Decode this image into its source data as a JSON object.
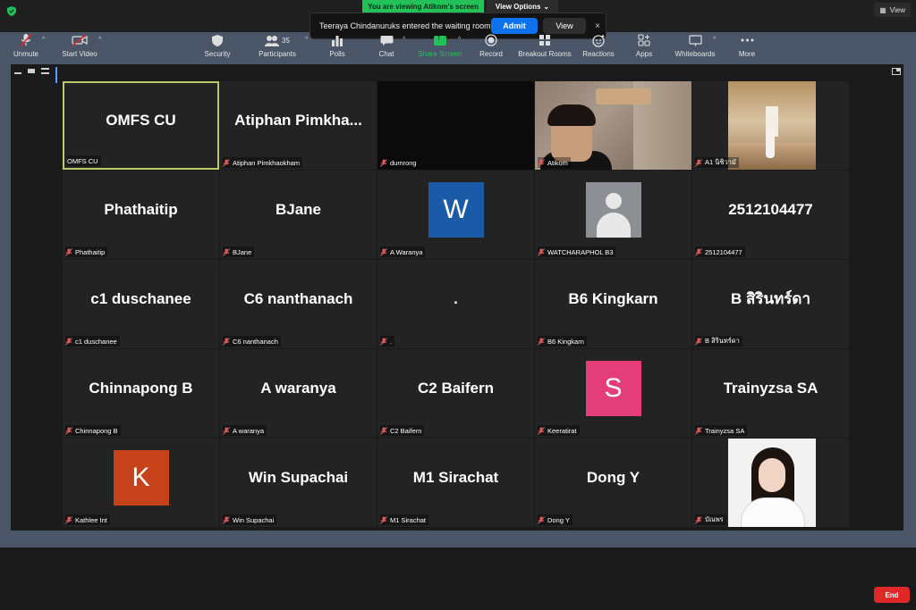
{
  "topbar": {
    "viewing_banner": "You are viewing Atikom's screen",
    "view_options": "View Options",
    "view_button": "View"
  },
  "waiting_toast": {
    "message": "Teeraya Chindanuruks entered the waiting room",
    "admit": "Admit",
    "view": "View",
    "close": "×"
  },
  "participants": [
    {
      "display": "OMFS CU",
      "label": "OMFS CU",
      "type": "name",
      "active": true,
      "muted": false
    },
    {
      "display": "Atiphan  Pimkha...",
      "label": "Atiphan Pimkhaokham",
      "type": "name",
      "muted": true
    },
    {
      "display": "",
      "label": "dumrong",
      "type": "video-dark",
      "muted": true
    },
    {
      "display": "",
      "label": "Atikom",
      "type": "video-cam",
      "muted": true
    },
    {
      "display": "",
      "label": "A1 นิชิวามั",
      "type": "photo-hall",
      "muted": true
    },
    {
      "display": "Phathaitip",
      "label": "Phathaitip",
      "type": "name",
      "muted": true
    },
    {
      "display": "BJane",
      "label": "BJane",
      "type": "name",
      "muted": true
    },
    {
      "display": "W",
      "label": "A Waranya",
      "type": "avatar",
      "color": "#1b5aa7",
      "muted": true
    },
    {
      "display": "",
      "label": "WATCHARAPHOL B3",
      "type": "avatar-default",
      "muted": true
    },
    {
      "display": "2512104477",
      "label": "2512104477",
      "type": "name",
      "muted": true
    },
    {
      "display": "c1 duschanee",
      "label": "c1 duschanee",
      "type": "name",
      "muted": true
    },
    {
      "display": "C6 nanthanach",
      "label": "C6 nanthanach",
      "type": "name",
      "muted": true
    },
    {
      "display": ".",
      "label": ".",
      "type": "name",
      "muted": true
    },
    {
      "display": "B6 Kingkarn",
      "label": "B6 Kingkarn",
      "type": "name",
      "muted": true
    },
    {
      "display": "B สิรินทร์ดา",
      "label": "B สิรินทร์ดา",
      "type": "name",
      "muted": true
    },
    {
      "display": "Chinnapong B",
      "label": "Chinnapong B",
      "type": "name",
      "muted": true
    },
    {
      "display": "A waranya",
      "label": "A waranya",
      "type": "name",
      "muted": true
    },
    {
      "display": "C2 Baifern",
      "label": "C2 Baifern",
      "type": "name",
      "muted": true
    },
    {
      "display": "S",
      "label": "Keeratirat",
      "type": "avatar",
      "color": "#e33d7a",
      "muted": true
    },
    {
      "display": "Trainyzsa SA",
      "label": "Trainyzsa SA",
      "type": "name",
      "muted": true
    },
    {
      "display": "K",
      "label": "Kathlee Int",
      "type": "avatar",
      "color": "#c6421b",
      "muted": true
    },
    {
      "display": "Win Supachai",
      "label": "Win Supachai",
      "type": "name",
      "muted": true
    },
    {
      "display": "M1 Sirachat",
      "label": "M1 Sirachat",
      "type": "name",
      "muted": true
    },
    {
      "display": "Dong Y",
      "label": "Dong Y",
      "type": "name",
      "muted": true
    },
    {
      "display": "",
      "label": "บัณพร",
      "type": "photo-portrait",
      "muted": true
    }
  ],
  "toolbar": {
    "unmute": "Unmute",
    "start_video": "Start Video",
    "security": "Security",
    "participants": "Participants",
    "participants_count": "35",
    "polls": "Polls",
    "chat": "Chat",
    "share_screen": "Share Screen",
    "record": "Record",
    "breakout_rooms": "Breakout Rooms",
    "reactions": "Reactions",
    "apps": "Apps",
    "whiteboards": "Whiteboards",
    "more": "More",
    "end": "End"
  },
  "colors": {
    "share_green": "#23c15a",
    "admit_blue": "#0e72ed",
    "end_red": "#e02828",
    "active_speaker_border": "#b9c96a"
  }
}
